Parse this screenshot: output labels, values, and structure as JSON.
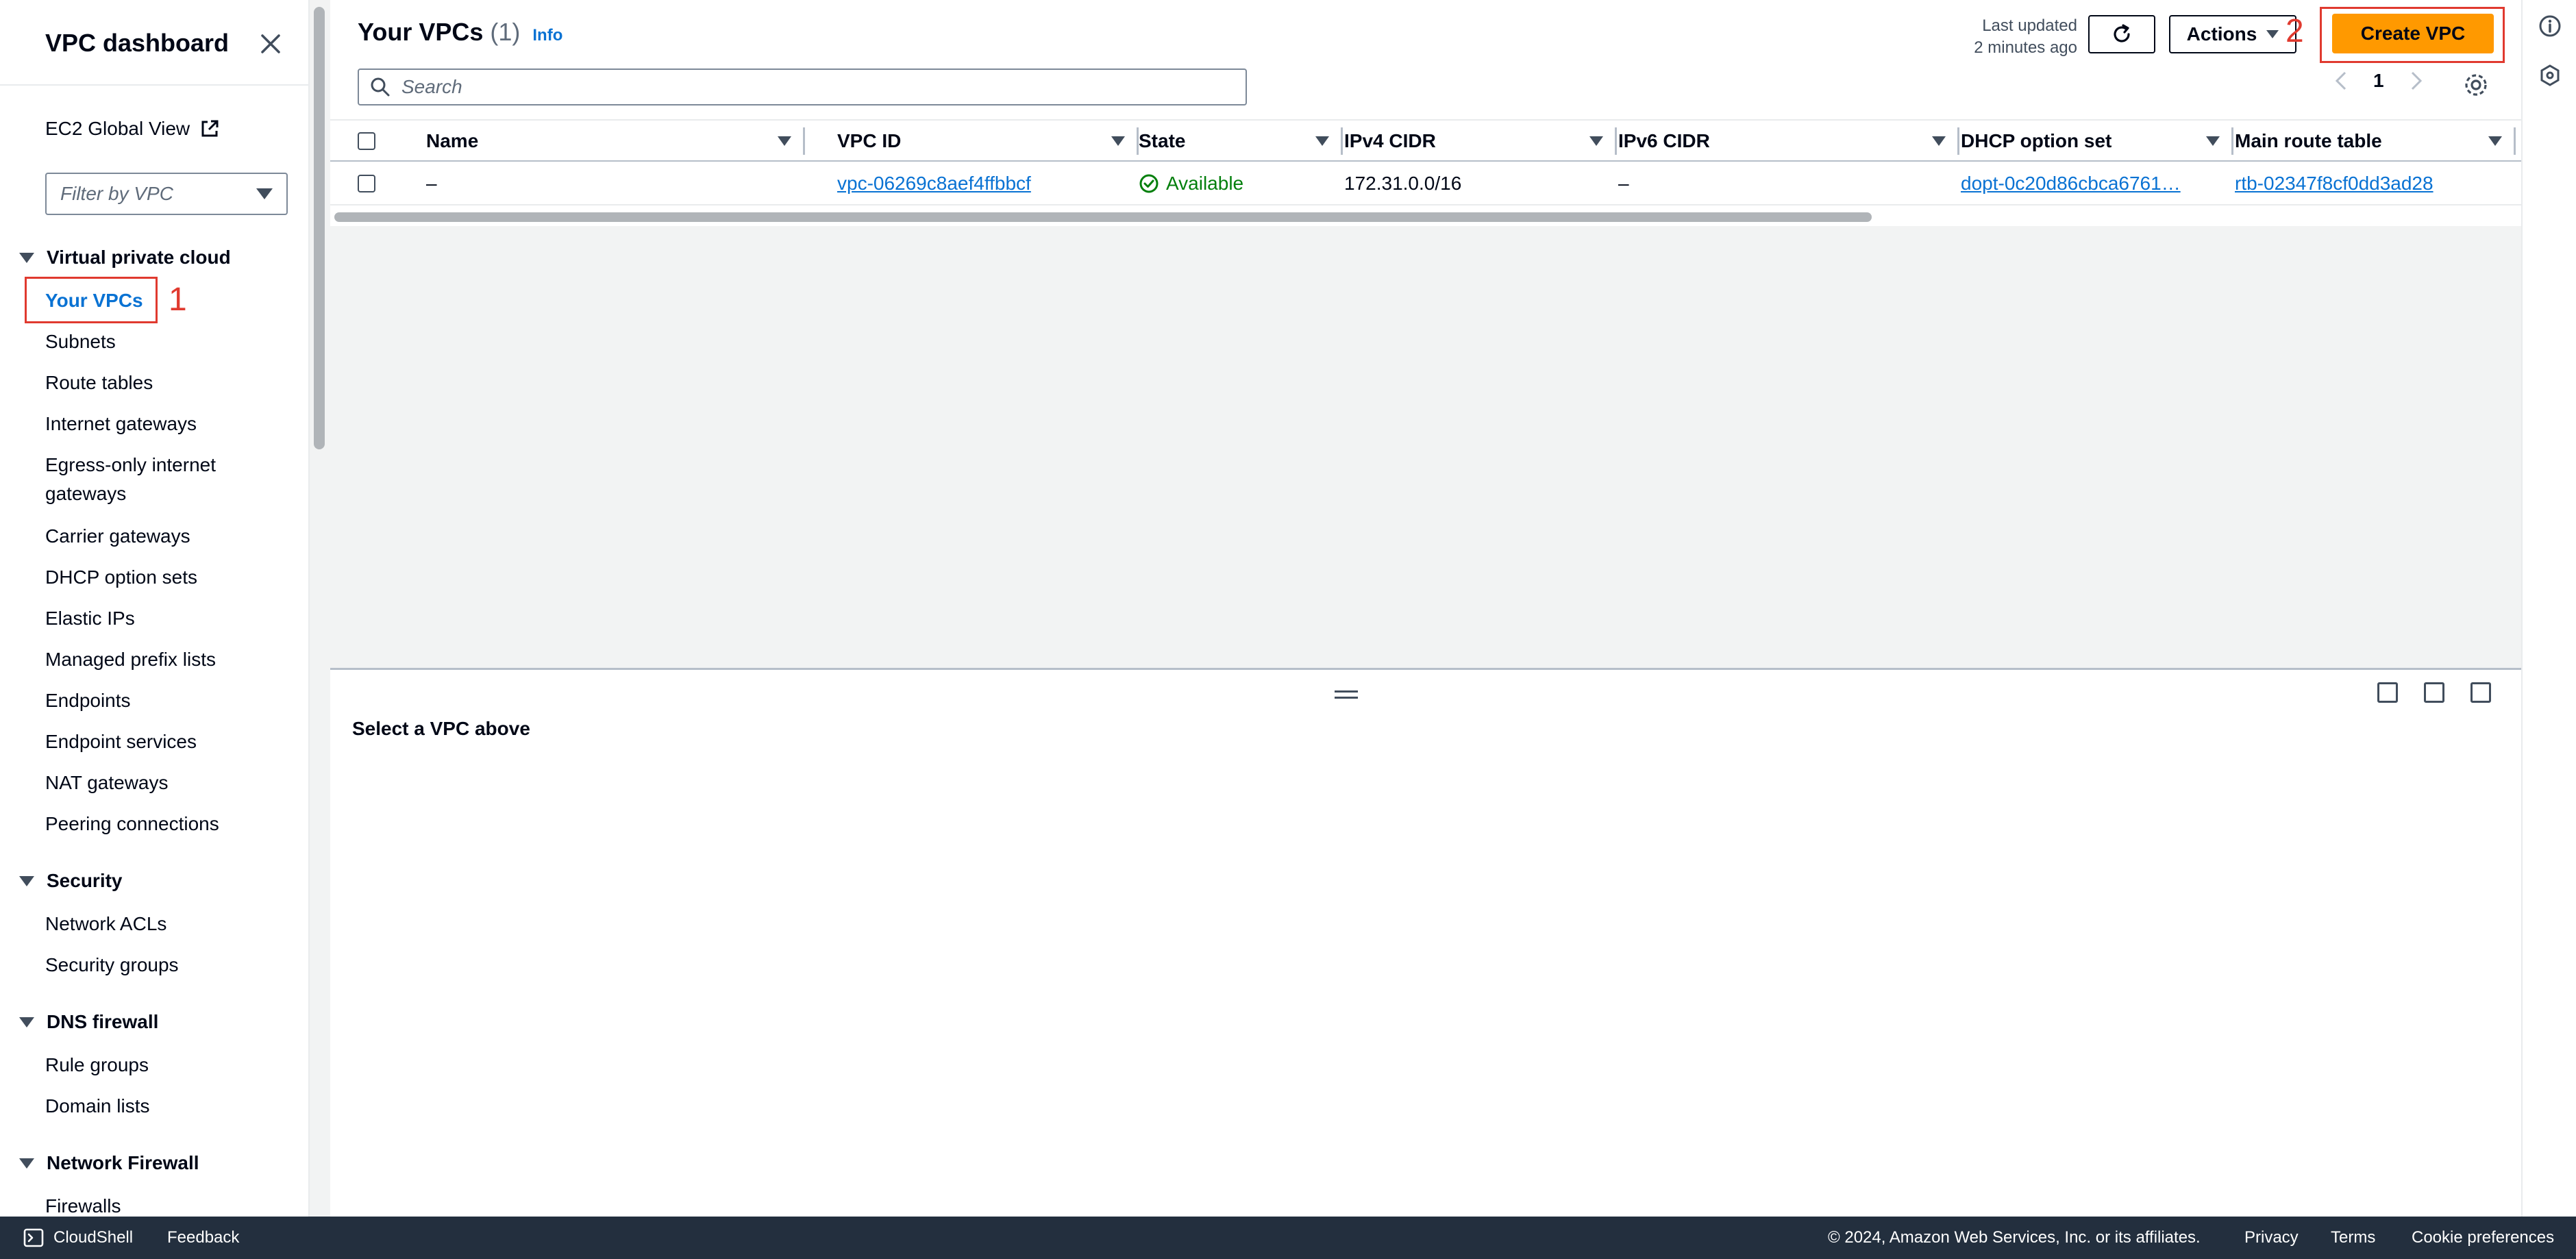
{
  "sidebar": {
    "title": "VPC dashboard",
    "ec2_global_view": "EC2 Global View",
    "filter_placeholder": "Filter by VPC",
    "sections": [
      {
        "label": "Virtual private cloud",
        "items": [
          "Your VPCs",
          "Subnets",
          "Route tables",
          "Internet gateways",
          "Egress-only internet gateways",
          "Carrier gateways",
          "DHCP option sets",
          "Elastic IPs",
          "Managed prefix lists",
          "Endpoints",
          "Endpoint services",
          "NAT gateways",
          "Peering connections"
        ]
      },
      {
        "label": "Security",
        "items": [
          "Network ACLs",
          "Security groups"
        ]
      },
      {
        "label": "DNS firewall",
        "items": [
          "Rule groups",
          "Domain lists"
        ]
      },
      {
        "label": "Network Firewall",
        "items": [
          "Firewalls"
        ]
      }
    ],
    "active_item": "Your VPCs"
  },
  "annotations": {
    "step1": "1",
    "step2": "2"
  },
  "main": {
    "title": "Your VPCs",
    "count": "(1)",
    "info_link": "Info",
    "last_updated_line1": "Last updated",
    "last_updated_line2": "2 minutes ago",
    "actions_label": "Actions",
    "create_label": "Create VPC",
    "search_placeholder": "Search",
    "page_number": "1",
    "columns": [
      "Name",
      "VPC ID",
      "State",
      "IPv4 CIDR",
      "IPv6 CIDR",
      "DHCP option set",
      "Main route table"
    ],
    "rows": [
      {
        "name": "–",
        "vpc_id": "vpc-06269c8aef4ffbbcf",
        "state": "Available",
        "ipv4": "172.31.0.0/16",
        "ipv6": "–",
        "dhcp": "dopt-0c20d86cbca6761…",
        "route_table": "rtb-02347f8cf0dd3ad28"
      }
    ],
    "detail_prompt": "Select a VPC above"
  },
  "footer": {
    "cloudshell": "CloudShell",
    "feedback": "Feedback",
    "copyright": "© 2024, Amazon Web Services, Inc. or its affiliates.",
    "privacy": "Privacy",
    "terms": "Terms",
    "cookies": "Cookie preferences"
  },
  "colors": {
    "accent": "#0972d3",
    "primary_button": "#ff9900",
    "annotation": "#e03a2f",
    "status_ok": "#037f0c",
    "footer_bg": "#232f3e"
  }
}
